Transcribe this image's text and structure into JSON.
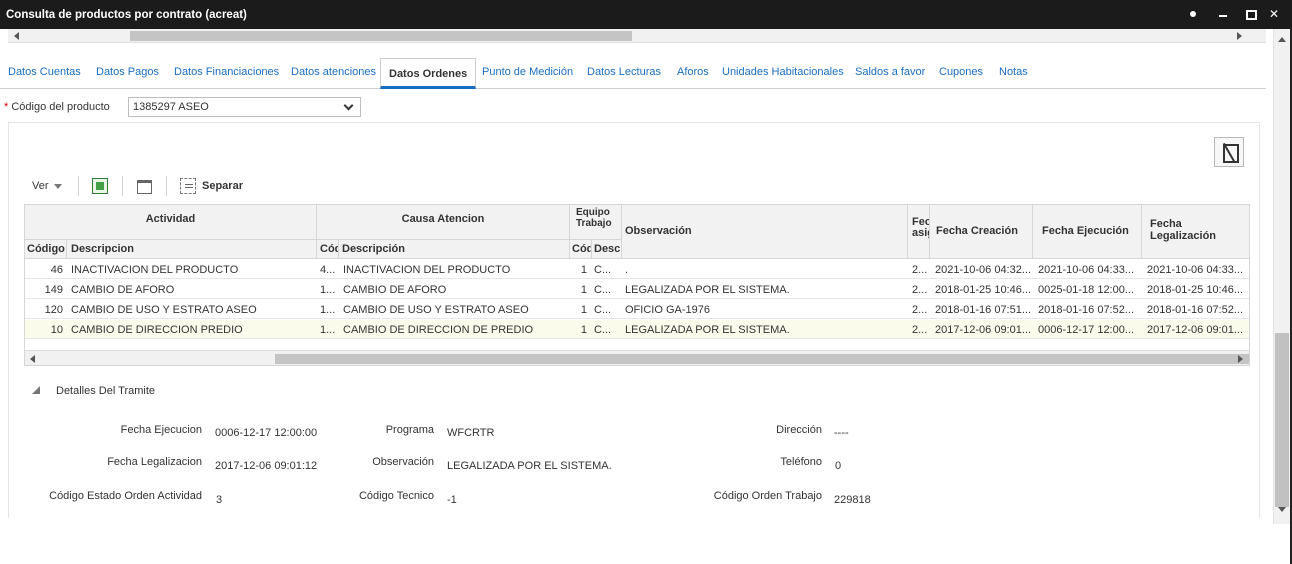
{
  "window": {
    "title": "Consulta de productos por contrato (acreat)"
  },
  "tabs": [
    {
      "label": "Datos Cuentas"
    },
    {
      "label": "Datos Pagos"
    },
    {
      "label": "Datos Financiaciones"
    },
    {
      "label": "Datos atenciones"
    },
    {
      "label": "Datos Ordenes",
      "active": true
    },
    {
      "label": "Punto de Medición"
    },
    {
      "label": "Datos Lecturas"
    },
    {
      "label": "Aforos"
    },
    {
      "label": "Unidades Habitacionales"
    },
    {
      "label": "Saldos a favor"
    },
    {
      "label": "Cupones"
    },
    {
      "label": "Notas"
    }
  ],
  "product": {
    "required_mark": "*",
    "label": "Código del producto",
    "value": "1385297 ASEO"
  },
  "toolbar": {
    "view_label": "Ver",
    "separate_label": "Separar"
  },
  "table": {
    "groups": {
      "actividad": "Actividad",
      "causa": "Causa Atencion",
      "equipo": "Equipo Trabajo"
    },
    "columns": {
      "codigo": "Código",
      "descripcion": "Descripcion",
      "causa_codigo": "Códi",
      "causa_descripcion": "Descripción",
      "equipo_codigo": "Códi",
      "equipo_descripcion": "Desc",
      "observacion": "Observación",
      "fecha_asig": "Fecha asignación",
      "fecha_creacion": "Fecha Creación",
      "fecha_ejecucion": "Fecha Ejecución",
      "fecha_legalizacion": "Fecha Legalización"
    },
    "rows": [
      {
        "codigo": "46",
        "descripcion": "INACTIVACION DEL PRODUCTO",
        "causa_codigo": "4...",
        "causa_descripcion": "INACTIVACION DEL PRODUCTO",
        "equipo_codigo": "1",
        "equipo_descripcion": "C...",
        "observacion": ".",
        "fecha_asig": "2...",
        "fecha_creacion": "2021-10-06 04:32...",
        "fecha_ejecucion": "2021-10-06 04:33...",
        "fecha_legalizacion": "2021-10-06 04:33..."
      },
      {
        "codigo": "149",
        "descripcion": "CAMBIO DE AFORO",
        "causa_codigo": "1...",
        "causa_descripcion": "CAMBIO DE AFORO",
        "equipo_codigo": "1",
        "equipo_descripcion": "C...",
        "observacion": "LEGALIZADA POR EL SISTEMA.",
        "fecha_asig": "2...",
        "fecha_creacion": "2018-01-25 10:46...",
        "fecha_ejecucion": "0025-01-18 12:00...",
        "fecha_legalizacion": "2018-01-25 10:46..."
      },
      {
        "codigo": "120",
        "descripcion": "CAMBIO DE USO Y ESTRATO ASEO",
        "causa_codigo": "1...",
        "causa_descripcion": "CAMBIO DE USO Y ESTRATO ASEO",
        "equipo_codigo": "1",
        "equipo_descripcion": "C...",
        "observacion": "OFICIO GA-1976",
        "fecha_asig": "2...",
        "fecha_creacion": "2018-01-16 07:51...",
        "fecha_ejecucion": "2018-01-16 07:52...",
        "fecha_legalizacion": "2018-01-16 07:52..."
      },
      {
        "codigo": "10",
        "descripcion": "CAMBIO DE DIRECCION PREDIO",
        "causa_codigo": "1...",
        "causa_descripcion": "CAMBIO DE DIRECCION DE PREDIO",
        "equipo_codigo": "1",
        "equipo_descripcion": "C...",
        "observacion": "LEGALIZADA POR EL SISTEMA.",
        "fecha_asig": "2...",
        "fecha_creacion": "2017-12-06 09:01...",
        "fecha_ejecucion": "0006-12-17 12:00...",
        "fecha_legalizacion": "2017-12-06 09:01..."
      }
    ]
  },
  "details": {
    "title": "Detalles Del Tramite",
    "fields": {
      "fecha_ejecucion": {
        "label": "Fecha Ejecucion",
        "value": "0006-12-17 12:00:00"
      },
      "programa": {
        "label": "Programa",
        "value": "WFCRTR"
      },
      "direccion": {
        "label": "Dirección",
        "value": "----"
      },
      "fecha_legalizacion": {
        "label": "Fecha Legalizacion",
        "value": "2017-12-06 09:01:12"
      },
      "observacion": {
        "label": "Observación",
        "value": "LEGALIZADA POR EL SISTEMA."
      },
      "telefono": {
        "label": "Teléfono",
        "value": "0"
      },
      "codigo_estado": {
        "label": "Código Estado Orden Actividad",
        "value": "3"
      },
      "codigo_tecnico": {
        "label": "Código Tecnico",
        "value": "-1"
      },
      "codigo_orden": {
        "label": "Código Orden Trabajo",
        "value": "229818"
      }
    }
  }
}
